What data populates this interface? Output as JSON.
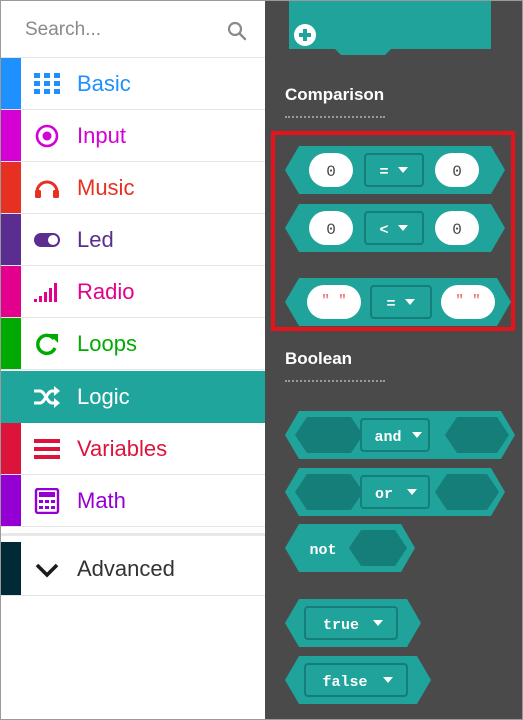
{
  "search": {
    "placeholder": "Search..."
  },
  "categories": [
    {
      "label": "Basic",
      "color": "#1e90ff",
      "icon": "grid-icon"
    },
    {
      "label": "Input",
      "color": "#d400d4",
      "icon": "target-icon"
    },
    {
      "label": "Music",
      "color": "#e63022",
      "icon": "headphones-icon"
    },
    {
      "label": "Led",
      "color": "#5c2d91",
      "icon": "toggle-icon"
    },
    {
      "label": "Radio",
      "color": "#e3008c",
      "icon": "signal-icon"
    },
    {
      "label": "Loops",
      "color": "#00aa00",
      "icon": "refresh-icon"
    },
    {
      "label": "Logic",
      "color": "#00a4a6",
      "icon": "shuffle-icon"
    },
    {
      "label": "Variables",
      "color": "#dc143c",
      "icon": "list-icon"
    },
    {
      "label": "Math",
      "color": "#9400d3",
      "icon": "calculator-icon"
    },
    {
      "label": "Advanced",
      "color": "#002b36",
      "icon": "chevron-down-icon"
    }
  ],
  "flyout": {
    "comparison_title": "Comparison",
    "boolean_title": "Boolean",
    "compare_eq": {
      "left": "0",
      "op": "=",
      "right": "0"
    },
    "compare_lt": {
      "left": "0",
      "op": "<",
      "right": "0"
    },
    "compare_str": {
      "left": "\" \"",
      "op": "=",
      "right": "\" \""
    },
    "and_label": "and",
    "or_label": "or",
    "not_label": "not",
    "true_label": "true",
    "false_label": "false"
  },
  "colors": {
    "logic_block": "#1fa39a",
    "logic_dark": "#157e78",
    "flyout_bg": "#4a4a4a",
    "highlight": "#e8121b"
  }
}
